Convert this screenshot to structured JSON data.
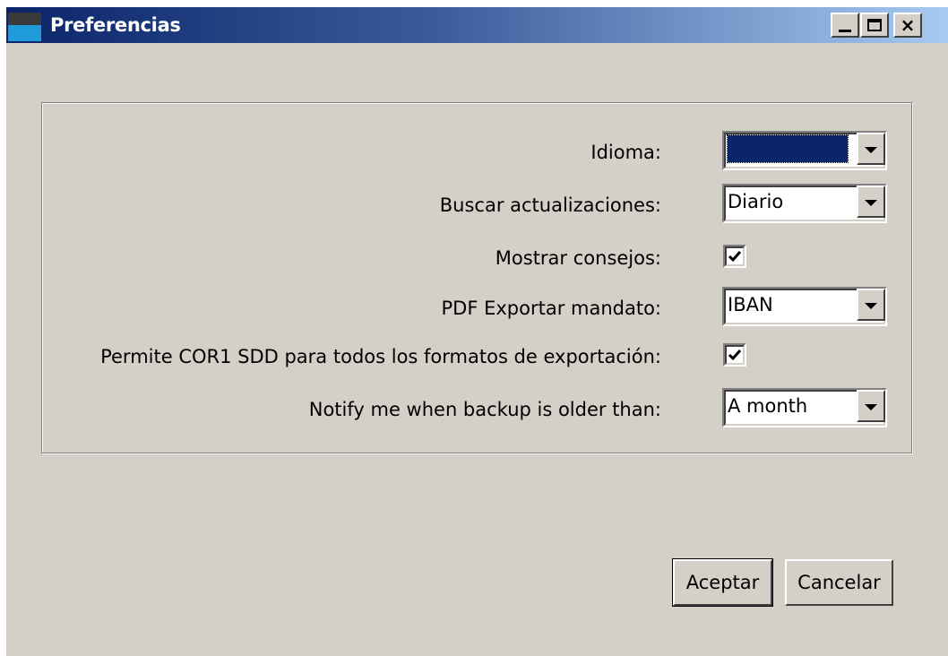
{
  "window": {
    "title": "Preferencias",
    "controls": {
      "minimize": "minimize-icon",
      "maximize": "maximize-icon",
      "close": "×"
    }
  },
  "form": {
    "language": {
      "label": "Idioma:",
      "value": ""
    },
    "check_updates": {
      "label": "Buscar actualizaciones:",
      "value": "Diario"
    },
    "show_tips": {
      "label": "Mostrar consejos:",
      "checked": true
    },
    "pdf_export_mandate": {
      "label": "PDF Exportar mandato:",
      "value": "IBAN"
    },
    "allow_cor1": {
      "label": "Permite COR1 SDD para todos los formatos de exportación:",
      "checked": true
    },
    "backup_notify": {
      "label": "Notify me when backup is older than:",
      "value": "A month"
    }
  },
  "buttons": {
    "ok": "Aceptar",
    "cancel": "Cancelar"
  },
  "colors": {
    "title_gradient_start": "#0a246a",
    "title_gradient_end": "#a6caf0",
    "window_bg": "#d4d0c8",
    "selection": "#0a246a"
  }
}
